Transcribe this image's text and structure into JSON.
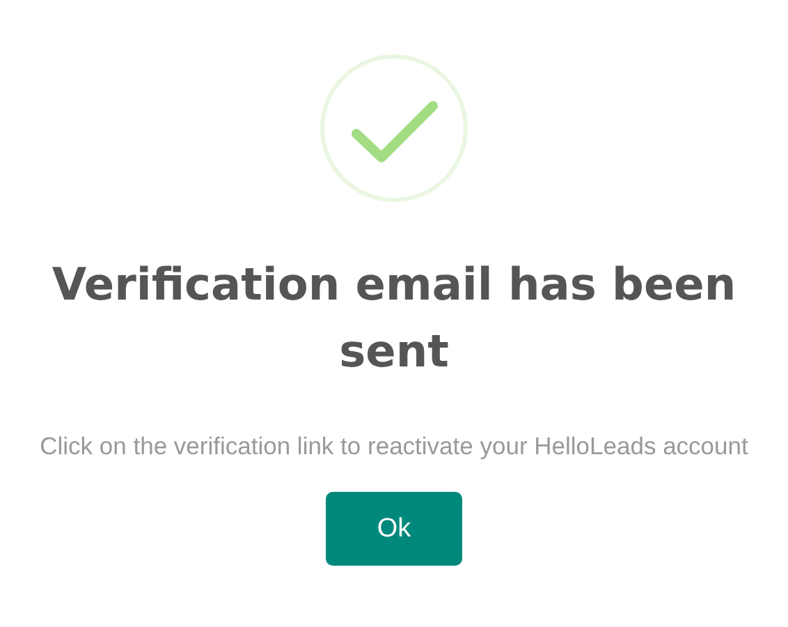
{
  "dialog": {
    "title": "Verification email has been sent",
    "message": "Click on the verification link to reactivate your HelloLeads account",
    "buttons": [
      "Ok"
    ]
  }
}
